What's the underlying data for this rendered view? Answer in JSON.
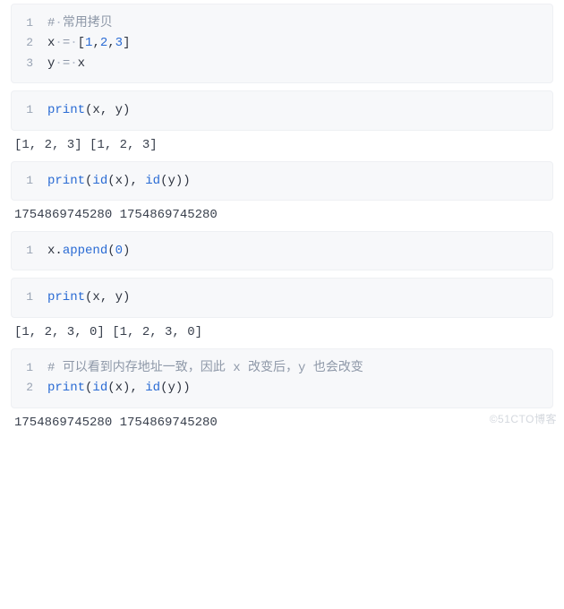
{
  "cells": [
    {
      "type": "code",
      "lines": [
        {
          "n": 1,
          "tokens": [
            {
              "t": "#",
              "c": "tok-comment"
            },
            {
              "t": "·",
              "c": "tok-ws"
            },
            {
              "t": "常用拷贝",
              "c": "tok-comment"
            }
          ]
        },
        {
          "n": 2,
          "tokens": [
            {
              "t": "x",
              "c": "tok-name"
            },
            {
              "t": "·",
              "c": "tok-ws"
            },
            {
              "t": "=",
              "c": "tok-op"
            },
            {
              "t": "·",
              "c": "tok-ws"
            },
            {
              "t": "[",
              "c": "tok-punct"
            },
            {
              "t": "1",
              "c": "tok-num"
            },
            {
              "t": ",",
              "c": "tok-punct"
            },
            {
              "t": "2",
              "c": "tok-num"
            },
            {
              "t": ",",
              "c": "tok-punct"
            },
            {
              "t": "3",
              "c": "tok-num"
            },
            {
              "t": "]",
              "c": "tok-punct"
            }
          ]
        },
        {
          "n": 3,
          "tokens": [
            {
              "t": "y",
              "c": "tok-name"
            },
            {
              "t": "·",
              "c": "tok-ws"
            },
            {
              "t": "=",
              "c": "tok-op"
            },
            {
              "t": "·",
              "c": "tok-ws"
            },
            {
              "t": "x",
              "c": "tok-name"
            }
          ]
        }
      ]
    },
    {
      "type": "code",
      "lines": [
        {
          "n": 1,
          "tokens": [
            {
              "t": "print",
              "c": "tok-func"
            },
            {
              "t": "(",
              "c": "tok-punct"
            },
            {
              "t": "x",
              "c": "tok-name"
            },
            {
              "t": ", ",
              "c": "tok-punct"
            },
            {
              "t": "y",
              "c": "tok-name"
            },
            {
              "t": ")",
              "c": "tok-punct"
            }
          ]
        }
      ]
    },
    {
      "type": "output",
      "text": "[1, 2, 3] [1, 2, 3]"
    },
    {
      "type": "code",
      "lines": [
        {
          "n": 1,
          "tokens": [
            {
              "t": "print",
              "c": "tok-func"
            },
            {
              "t": "(",
              "c": "tok-punct"
            },
            {
              "t": "id",
              "c": "tok-func"
            },
            {
              "t": "(",
              "c": "tok-punct"
            },
            {
              "t": "x",
              "c": "tok-name"
            },
            {
              "t": ")",
              "c": "tok-punct"
            },
            {
              "t": ", ",
              "c": "tok-punct"
            },
            {
              "t": "id",
              "c": "tok-func"
            },
            {
              "t": "(",
              "c": "tok-punct"
            },
            {
              "t": "y",
              "c": "tok-name"
            },
            {
              "t": ")",
              "c": "tok-punct"
            },
            {
              "t": ")",
              "c": "tok-punct"
            }
          ]
        }
      ]
    },
    {
      "type": "output",
      "text": "1754869745280 1754869745280"
    },
    {
      "type": "code",
      "lines": [
        {
          "n": 1,
          "tokens": [
            {
              "t": "x",
              "c": "tok-name"
            },
            {
              "t": ".",
              "c": "tok-punct"
            },
            {
              "t": "append",
              "c": "tok-method"
            },
            {
              "t": "(",
              "c": "tok-punct"
            },
            {
              "t": "0",
              "c": "tok-num"
            },
            {
              "t": ")",
              "c": "tok-punct"
            }
          ]
        }
      ]
    },
    {
      "type": "code",
      "lines": [
        {
          "n": 1,
          "tokens": [
            {
              "t": "print",
              "c": "tok-func"
            },
            {
              "t": "(",
              "c": "tok-punct"
            },
            {
              "t": "x",
              "c": "tok-name"
            },
            {
              "t": ", ",
              "c": "tok-punct"
            },
            {
              "t": "y",
              "c": "tok-name"
            },
            {
              "t": ")",
              "c": "tok-punct"
            }
          ]
        }
      ]
    },
    {
      "type": "output",
      "text": "[1, 2, 3, 0] [1, 2, 3, 0]"
    },
    {
      "type": "code",
      "lines": [
        {
          "n": 1,
          "tokens": [
            {
              "t": "# 可以看到内存地址一致，因此 x 改变后，y 也会改变",
              "c": "tok-comment"
            }
          ]
        },
        {
          "n": 2,
          "tokens": [
            {
              "t": "print",
              "c": "tok-func"
            },
            {
              "t": "(",
              "c": "tok-punct"
            },
            {
              "t": "id",
              "c": "tok-func"
            },
            {
              "t": "(",
              "c": "tok-punct"
            },
            {
              "t": "x",
              "c": "tok-name"
            },
            {
              "t": ")",
              "c": "tok-punct"
            },
            {
              "t": ", ",
              "c": "tok-punct"
            },
            {
              "t": "id",
              "c": "tok-func"
            },
            {
              "t": "(",
              "c": "tok-punct"
            },
            {
              "t": "y",
              "c": "tok-name"
            },
            {
              "t": ")",
              "c": "tok-punct"
            },
            {
              "t": ")",
              "c": "tok-punct"
            }
          ]
        }
      ]
    },
    {
      "type": "output",
      "text": "1754869745280 1754869745280"
    }
  ],
  "watermark": "©51CTO博客"
}
